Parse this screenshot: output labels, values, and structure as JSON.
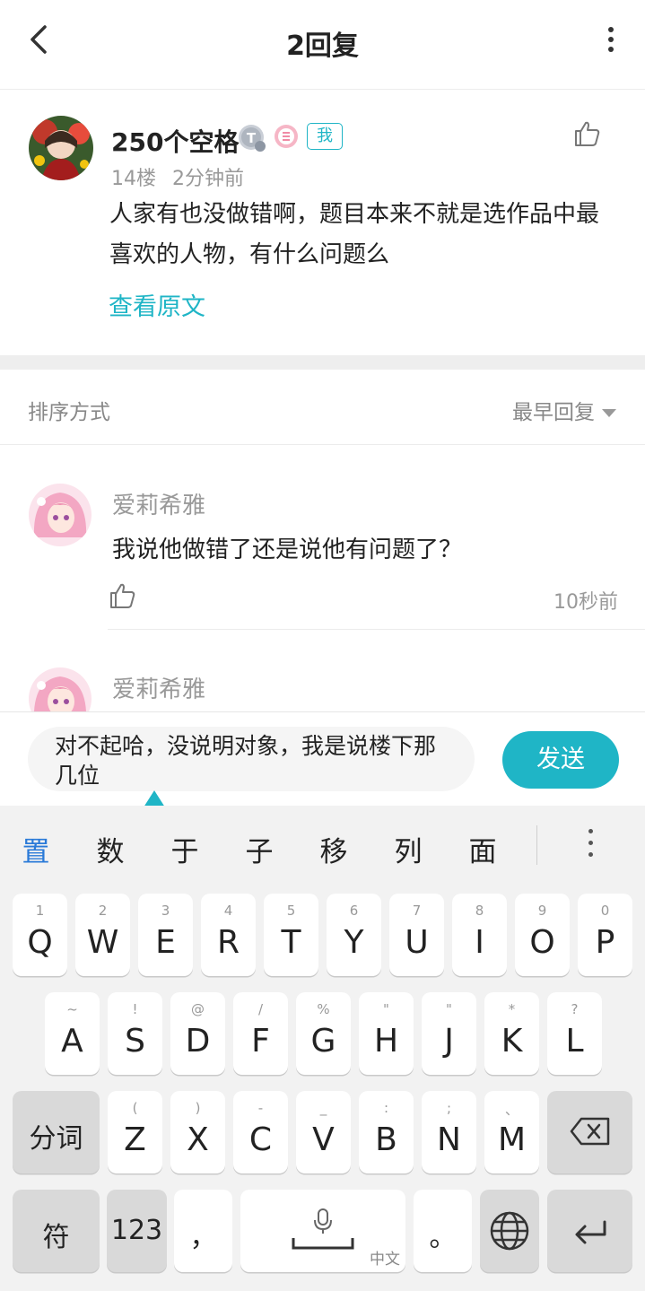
{
  "header": {
    "title": "2回复"
  },
  "post": {
    "username": "250个空格",
    "badge_me": "我",
    "floor": "14楼",
    "time": "2分钟前",
    "text": "人家有也没做错啊，题目本来不就是选作品中最喜欢的人物，有什么问题么",
    "view_original": "查看原文"
  },
  "sort": {
    "label": "排序方式",
    "selected": "最早回复"
  },
  "replies": [
    {
      "username": "爱莉希雅",
      "text": "我说他做错了还是说他有问题了？",
      "time": "10秒前"
    },
    {
      "username": "爱莉希雅"
    }
  ],
  "input": {
    "value": "对不起哈，没说明对象，我是说楼下那几位",
    "send_label": "发送"
  },
  "keyboard": {
    "candidates": [
      "置",
      "数",
      "于",
      "子",
      "移",
      "列",
      "面"
    ],
    "row1": [
      {
        "hint": "1",
        "key": "Q"
      },
      {
        "hint": "2",
        "key": "W"
      },
      {
        "hint": "3",
        "key": "E"
      },
      {
        "hint": "4",
        "key": "R"
      },
      {
        "hint": "5",
        "key": "T"
      },
      {
        "hint": "6",
        "key": "Y"
      },
      {
        "hint": "7",
        "key": "U"
      },
      {
        "hint": "8",
        "key": "I"
      },
      {
        "hint": "9",
        "key": "O"
      },
      {
        "hint": "0",
        "key": "P"
      }
    ],
    "row2": [
      {
        "hint": "~",
        "key": "A"
      },
      {
        "hint": "!",
        "key": "S"
      },
      {
        "hint": "@",
        "key": "D"
      },
      {
        "hint": "/",
        "key": "F"
      },
      {
        "hint": "%",
        "key": "G"
      },
      {
        "hint": "\"",
        "key": "H"
      },
      {
        "hint": "\"",
        "key": "J"
      },
      {
        "hint": "*",
        "key": "K"
      },
      {
        "hint": "?",
        "key": "L"
      }
    ],
    "row3": [
      {
        "hint": "(",
        "key": "Z"
      },
      {
        "hint": ")",
        "key": "X"
      },
      {
        "hint": "-",
        "key": "C"
      },
      {
        "hint": "_",
        "key": "V"
      },
      {
        "hint": ":",
        "key": "B"
      },
      {
        "hint": ";",
        "key": "N"
      },
      {
        "hint": "、",
        "key": "M"
      }
    ],
    "segment_label": "分词",
    "symbol_label": "符",
    "numbers_label": "123",
    "comma_label": "，",
    "space_sublabel": "中文",
    "period_label": "。"
  }
}
